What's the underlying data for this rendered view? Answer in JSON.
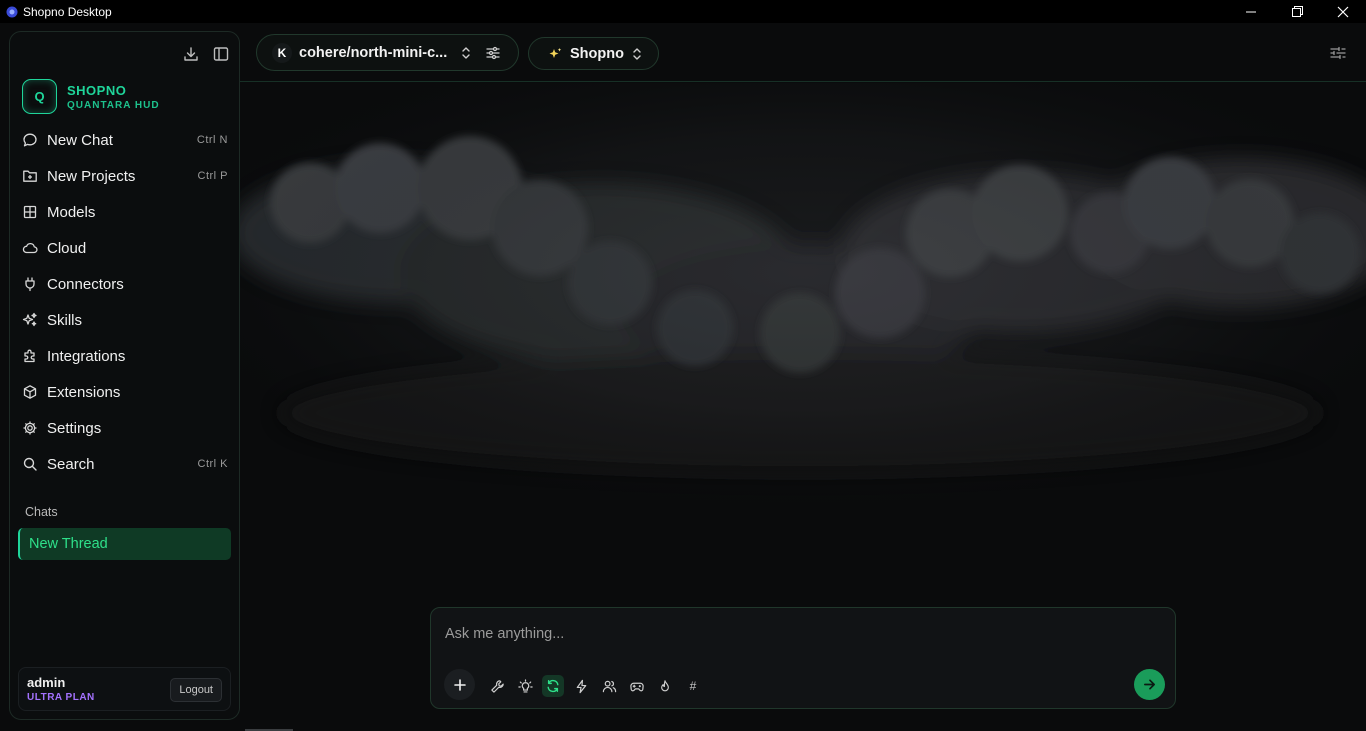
{
  "window": {
    "title": "Shopno Desktop",
    "icons": [
      "app-icon",
      "minimize-icon",
      "restore-icon",
      "close-icon"
    ]
  },
  "sidebar": {
    "brand": {
      "logo_letter": "Q",
      "name": "SHOPNO",
      "subtitle": "QUANTARA HUD"
    },
    "tool_icons": [
      "download-icon",
      "sidebar-toggle-icon"
    ],
    "items": [
      {
        "label": "New Chat",
        "icon": "chat-bubble-icon",
        "shortcut": "Ctrl N"
      },
      {
        "label": "New Projects",
        "icon": "folder-plus-icon",
        "shortcut": "Ctrl P"
      },
      {
        "label": "Models",
        "icon": "grid-icon",
        "shortcut": ""
      },
      {
        "label": "Cloud",
        "icon": "cloud-icon",
        "shortcut": ""
      },
      {
        "label": "Connectors",
        "icon": "plug-icon",
        "shortcut": ""
      },
      {
        "label": "Skills",
        "icon": "sparkles-icon",
        "shortcut": ""
      },
      {
        "label": "Integrations",
        "icon": "puzzle-icon",
        "shortcut": ""
      },
      {
        "label": "Extensions",
        "icon": "box-icon",
        "shortcut": ""
      },
      {
        "label": "Settings",
        "icon": "gear-icon",
        "shortcut": ""
      },
      {
        "label": "Search",
        "icon": "search-icon",
        "shortcut": "Ctrl K"
      }
    ],
    "chats_heading": "Chats",
    "threads": [
      {
        "label": "New Thread",
        "active": true
      }
    ],
    "user": {
      "name": "admin",
      "plan": "ULTRA PLAN",
      "logout_label": "Logout"
    }
  },
  "topbar": {
    "model": {
      "badge": "K",
      "name": "cohere/north-mini-c..."
    },
    "persona": {
      "name": "Shopno",
      "icon": "sparkle-icon"
    },
    "right_icon": "sliders-icon"
  },
  "composer": {
    "placeholder": "Ask me anything...",
    "tools": [
      "wrench-icon",
      "lightbulb-icon",
      "refresh-icon",
      "lightning-icon",
      "users-icon",
      "gamepad-icon",
      "flame-icon"
    ],
    "hash_label": "#",
    "active_tool": "refresh-icon"
  },
  "colors": {
    "accent": "#1fd59a",
    "thread_bg": "#0f3a25",
    "plan": "#a472ff",
    "send": "#1a9c5a"
  }
}
